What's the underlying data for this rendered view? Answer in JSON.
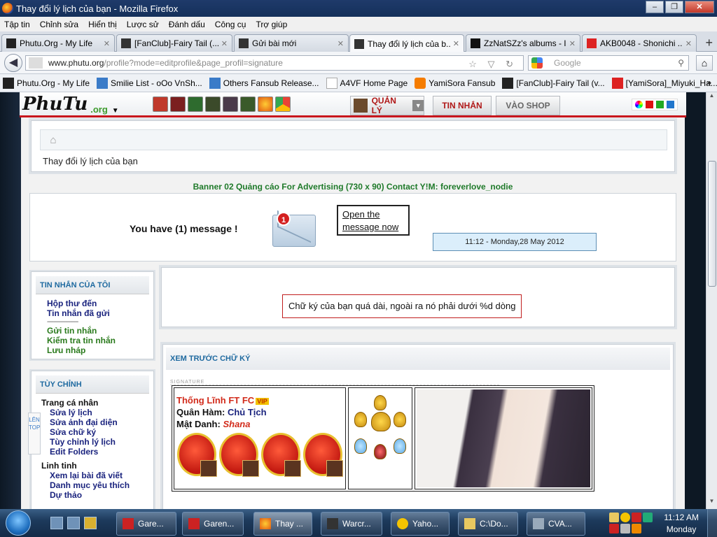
{
  "window": {
    "title": "Thay đổi lý lịch của bạn - Mozilla Firefox",
    "minimize": "‒",
    "maximize": "❐",
    "close": "✕"
  },
  "menu": [
    "Tập tin",
    "Chỉnh sửa",
    "Hiển thị",
    "Lược sử",
    "Đánh dấu",
    "Công cụ",
    "Trợ giúp"
  ],
  "tabs": [
    {
      "label": "Phutu.Org - My Life",
      "active": false
    },
    {
      "label": "[FanClub]-Fairy Tail (...",
      "active": false
    },
    {
      "label": "Gửi bài mới",
      "active": false
    },
    {
      "label": "Thay đổi lý lịch của b...",
      "active": true
    },
    {
      "label": "ZzNatSZz's albums - I...",
      "active": false
    },
    {
      "label": "AKB0048 - Shonichi ...",
      "active": false
    }
  ],
  "tab_close": "✕",
  "new_tab": "+",
  "nav": {
    "back": "◀",
    "url_host": "www.phutu.org",
    "url_path": "/profile?mode=editprofile&page_profil=signature",
    "url_icons": "☆ ▽ ↻",
    "search_placeholder": "Google",
    "search_go": "⚲",
    "home": "⌂"
  },
  "bookmarks": [
    "Phutu.Org - My Life",
    "Smilie List - oOo VnSh...",
    "Others Fansub Release...",
    "A4VF Home Page",
    "YamiSora Fansub",
    "[FanClub]-Fairy Tail (v...",
    "[YamiSora]_Miyuki_Ha..."
  ],
  "bookmarks_more": "»",
  "site": {
    "logo_main": "PhuTu",
    "logo_org": ".org",
    "logo_arrow": "▼",
    "admin_label": "QUẢN LÝ",
    "admin_dd": "▼",
    "messages_button": "TIN NHẮN",
    "shop_button": "VÀO SHOP",
    "home_icon": "⌂",
    "page_title": "Thay đổi lý lịch của bạn",
    "banner": "Banner 02 Quảng cáo For Advertising (730 x 90) Contact Y!M: foreverlove_nodie",
    "you_have": "You have (1) message !",
    "badge_count": "1",
    "bubble": "Open the message now",
    "clock": "11:12 - Monday,28 May 2012"
  },
  "sidebar": {
    "inbox_header": "TIN NHẮN CỦA TÔI",
    "inbox_items": [
      "Hộp thư đến",
      "Tin nhắn đã gửi"
    ],
    "dash": "-------------------",
    "inbox_actions": [
      "Gửi tin nhắn",
      "Kiểm tra tin nhắn",
      "Lưu nháp"
    ],
    "custom_header": "TÙY CHỈNH",
    "profile_section": "Trang cá nhân",
    "profile_items": [
      "Sửa lý lịch",
      "Sửa ảnh đại diện",
      "Sửa chữ ký",
      "Tùy chỉnh lý lịch",
      "Edit Folders"
    ],
    "misc_section": "Linh tinh",
    "misc_items": [
      "Xem lại bài đã viết",
      "Danh mục yêu thích",
      "Dự thảo"
    ],
    "lentop": "LÊN TOP"
  },
  "error_message": "Chữ ký của bạn quá dài, ngoài ra nó phải dưới %d dòng",
  "preview": {
    "header": "XEM TRƯỚC CHỮ KÝ",
    "sig_tag": "SIGNATURE",
    "name_line": "Thống Lĩnh FT FC",
    "vip": "VIP",
    "rank_label": "Quân Hàm:",
    "rank_value": "Chủ Tịch",
    "code_label": "Mật Danh:",
    "code_value": "Shana"
  },
  "taskbar": {
    "buttons": [
      "Gare...",
      "Garen...",
      "Thay ...",
      "Warcr...",
      "Yaho...",
      "C:\\Do...",
      "CVA..."
    ],
    "time": "11:12 AM",
    "day": "Monday"
  },
  "colors": {
    "accent_red": "#c8161d",
    "green_text": "#2a7a1c",
    "navy_text": "#1a237e",
    "header_blue": "#1f6aa0"
  }
}
